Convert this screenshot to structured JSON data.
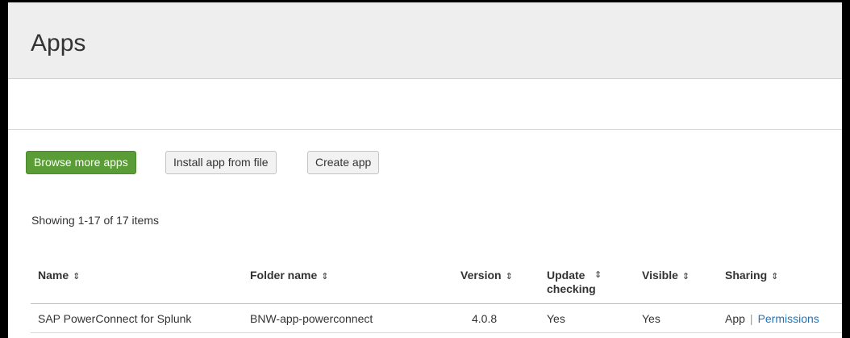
{
  "page": {
    "title": "Apps"
  },
  "actions": {
    "browse": "Browse more apps",
    "install": "Install app from file",
    "create": "Create app"
  },
  "pagination": {
    "summary": "Showing 1-17 of 17 items"
  },
  "table": {
    "sort_icon": "sort-icon",
    "columns": {
      "name": "Name",
      "folder": "Folder name",
      "version": "Version",
      "update_line1": "Update",
      "update_line2": "checking",
      "visible": "Visible",
      "sharing": "Sharing"
    },
    "rows": [
      {
        "name": "SAP PowerConnect for Splunk",
        "folder": "BNW-app-powerconnect",
        "version": "4.0.8",
        "update_checking": "Yes",
        "visible": "Yes",
        "sharing": "App",
        "sharing_separator": "|",
        "permissions": "Permissions"
      }
    ]
  },
  "colors": {
    "header_bg": "#eeeeee",
    "primary_button": "#5a9c35",
    "link": "#1e73be"
  }
}
